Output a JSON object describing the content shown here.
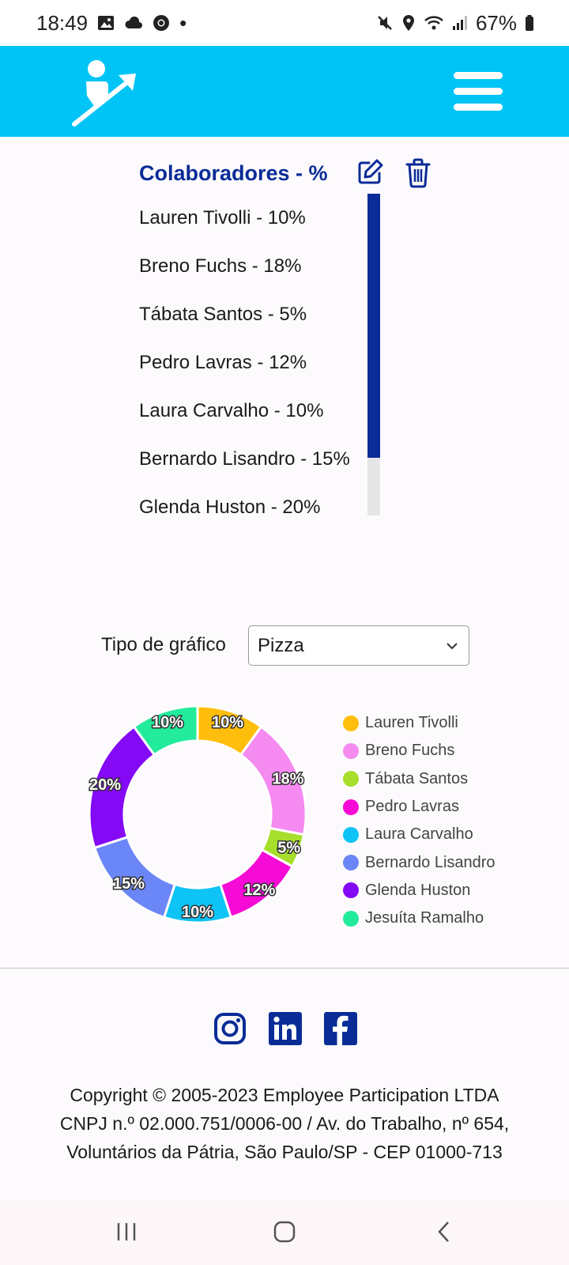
{
  "status": {
    "time": "18:49",
    "dot": "•",
    "battery": "67%",
    "icons_left": [
      "image-icon",
      "cloud-icon",
      "chrome-icon"
    ],
    "icons_right": [
      "mute-icon",
      "location-icon",
      "wifi-icon",
      "signal-icon",
      "battery-icon"
    ]
  },
  "header": {
    "logo": "employee-participation-logo",
    "menu_icon": "hamburger-menu-icon",
    "color": "#00c4f5"
  },
  "collaborators": {
    "title": "Colaboradores - %",
    "items": [
      "Lauren Tivolli - 10%",
      "Breno Fuchs - 18%",
      "Tábata Santos - 5%",
      "Pedro Lavras - 12%",
      "Laura Carvalho - 10%",
      "Bernardo Lisandro - 15%",
      "Glenda Huston - 20%"
    ],
    "scroll_position": 0.82
  },
  "chart_type": {
    "label": "Tipo de gráfico",
    "value": "Pizza"
  },
  "chart_data": {
    "type": "pie",
    "variant": "donut",
    "categories": [
      "Lauren Tivolli",
      "Breno Fuchs",
      "Tábata Santos",
      "Pedro Lavras",
      "Laura Carvalho",
      "Bernardo Lisandro",
      "Glenda Huston",
      "Jesuíta Ramalho"
    ],
    "values": [
      10,
      18,
      5,
      12,
      10,
      15,
      20,
      10
    ],
    "labels": [
      "10%",
      "18%",
      "5%",
      "12%",
      "10%",
      "15%",
      "20%",
      "10%"
    ],
    "colors": [
      "#ffbe0b",
      "#f58af0",
      "#a7de2c",
      "#f50ad6",
      "#0ec3f5",
      "#6b86f7",
      "#8409f5",
      "#22eb9c"
    ],
    "legend_position": "right"
  },
  "footer": {
    "social": [
      "instagram-icon",
      "linkedin-icon",
      "facebook-icon"
    ],
    "line1": "Copyright © 2005-2023 Employee Participation LTDA",
    "line2": "CNPJ n.º 02.000.751/0006-00 / Av. do Trabalho, nº 654,",
    "line3": "Voluntários da Pátria, São Paulo/SP - CEP 01000-713",
    "brand_color": "#0a2c97"
  },
  "nav": [
    "recent-apps-icon",
    "home-icon",
    "back-icon"
  ]
}
